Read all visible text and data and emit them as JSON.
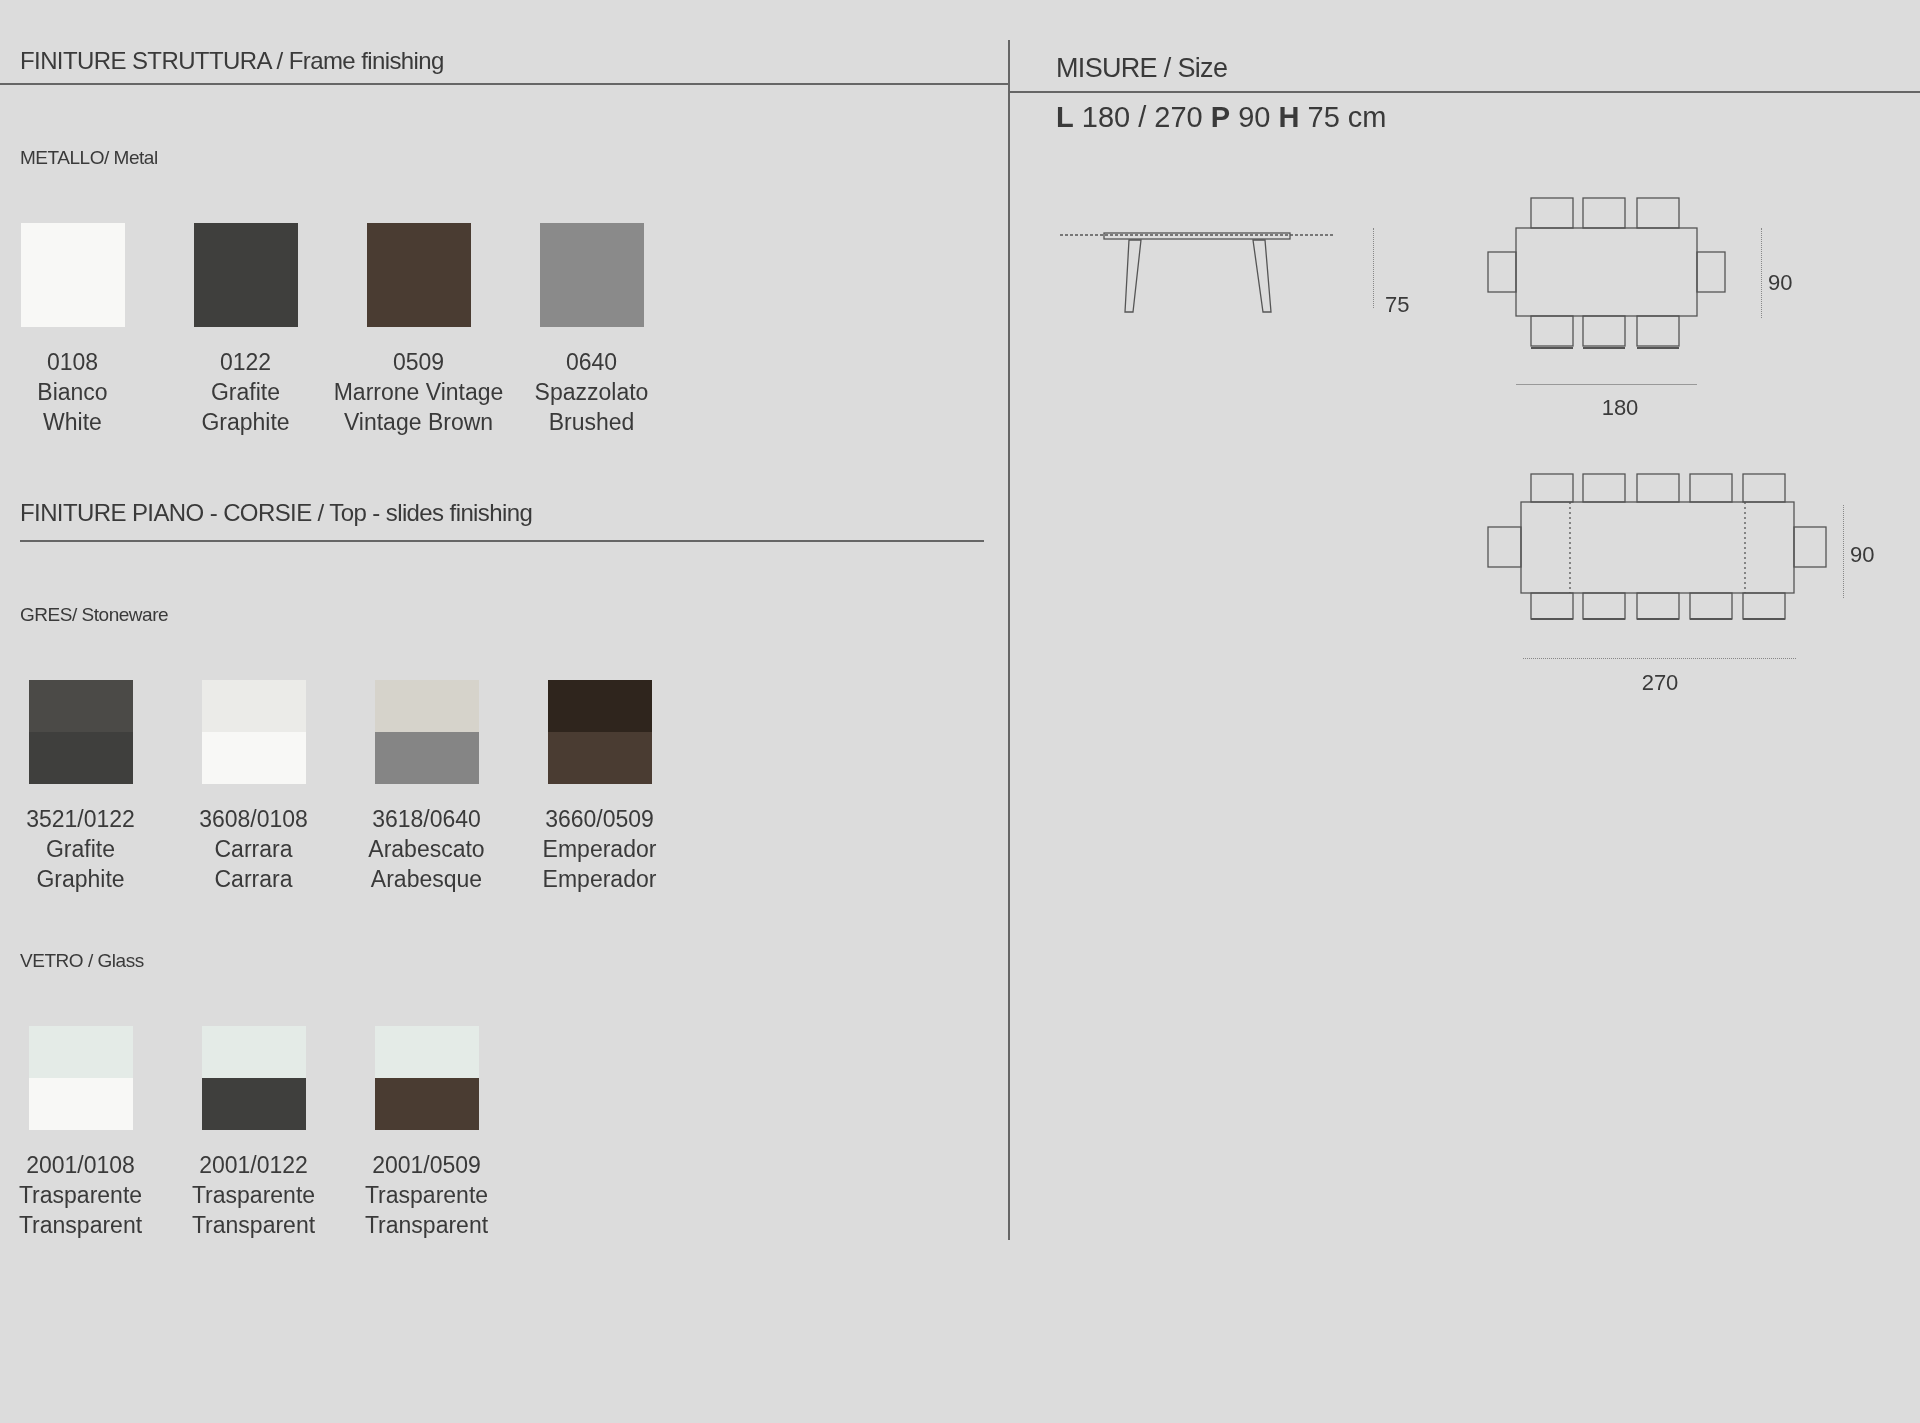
{
  "finishes": {
    "title": "FINITURE STRUTTURA / Frame finishing",
    "groups": [
      {
        "title": "METALLO/ Metal",
        "swatches": [
          {
            "code": "0108",
            "names": [
              "Bianco",
              "White"
            ],
            "parts": [
              {
                "color": "#f8f8f6"
              }
            ]
          },
          {
            "code": "0122",
            "names": [
              "Grafite",
              "Graphite"
            ],
            "parts": [
              {
                "color": "#3f3f3d"
              }
            ]
          },
          {
            "code": "0509",
            "names": [
              "Marrone Vintage",
              "Vintage Brown"
            ],
            "parts": [
              {
                "color": "#4a3c32"
              }
            ]
          },
          {
            "code": "0640",
            "names": [
              "Spazzolato",
              "Brushed"
            ],
            "parts": [
              {
                "color": "#8a8a8a"
              }
            ]
          }
        ]
      }
    ]
  },
  "top_finishes": {
    "title": "FINITURE PIANO - CORSIE / Top - slides finishing",
    "groups": [
      {
        "title": "GRES/ Stoneware",
        "swatches": [
          {
            "code": "3521/0122",
            "names": [
              "Grafite",
              "Graphite"
            ],
            "parts": [
              {
                "color": "#4b4a47"
              },
              {
                "color": "#3f3f3d"
              }
            ]
          },
          {
            "code": "3608/0108",
            "names": [
              "Carrara",
              "Carrara"
            ],
            "parts": [
              {
                "color": "#ebebe8"
              },
              {
                "color": "#f8f8f6"
              }
            ]
          },
          {
            "code": "3618/0640",
            "names": [
              "Arabescato",
              "Arabesque"
            ],
            "parts": [
              {
                "color": "#d6d3cb"
              },
              {
                "color": "#858585"
              }
            ]
          },
          {
            "code": "3660/0509",
            "names": [
              "Emperador",
              "Emperador"
            ],
            "parts": [
              {
                "color": "#2f251d"
              },
              {
                "color": "#4a3c32"
              }
            ]
          }
        ]
      },
      {
        "title": "VETRO / Glass",
        "swatches": [
          {
            "code": "2001/0108",
            "names": [
              "Trasparente",
              "Transparent"
            ],
            "parts": [
              {
                "color": "#e4ebe7"
              },
              {
                "color": "#f8f8f6"
              }
            ]
          },
          {
            "code": "2001/0122",
            "names": [
              "Trasparente",
              "Transparent"
            ],
            "parts": [
              {
                "color": "#e4ebe7"
              },
              {
                "color": "#3f3f3d"
              }
            ]
          },
          {
            "code": "2001/0509",
            "names": [
              "Trasparente",
              "Transparent"
            ],
            "parts": [
              {
                "color": "#e4ebe7"
              },
              {
                "color": "#4a3c32"
              }
            ]
          }
        ]
      }
    ]
  },
  "size": {
    "title": "MISURE / Size",
    "dimensions": "**L** 180 / 270 **P** 90 **H** 75 cm",
    "side_view": {
      "height_label": "75"
    },
    "top_views": [
      {
        "kind": "closed",
        "depth_label": "90",
        "length_label": "180"
      },
      {
        "kind": "extended",
        "depth_label": "90",
        "length_label": "270"
      }
    ]
  }
}
